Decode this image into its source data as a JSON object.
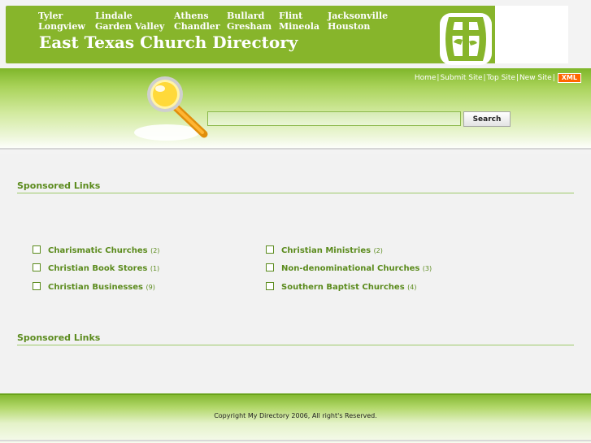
{
  "banner": {
    "cities": [
      "Tyler",
      "Lindale",
      "Athens",
      "Bullard",
      "Flint",
      "Jacksonville",
      "Longview",
      "Garden Valley",
      "Chandler",
      "Gresham",
      "Mineola",
      "Houston"
    ],
    "title": "East Texas Church Directory"
  },
  "top_links": {
    "home": "Home",
    "submit": "Submit Site",
    "top": "Top Site",
    "new": "New Site",
    "xml": "XML",
    "separator": "|"
  },
  "search": {
    "input_value": "",
    "button_label": "Search"
  },
  "sponsored_heading": "Sponsored Links",
  "categories": [
    {
      "name": "Charismatic Churches",
      "count": "(2)"
    },
    {
      "name": "Christian Ministries",
      "count": "(2)"
    },
    {
      "name": "Christian Book Stores",
      "count": "(1)"
    },
    {
      "name": "Non-denominational Churches",
      "count": "(3)"
    },
    {
      "name": "Christian Businesses",
      "count": "(9)"
    },
    {
      "name": "Southern Baptist Churches",
      "count": "(4)"
    }
  ],
  "footer": {
    "copyright": "Copyright My Directory 2006, All right's Reserved."
  },
  "colors": {
    "brand_green": "#87b52b",
    "link_green": "#5b8b1d",
    "xml_orange": "#ff6600"
  }
}
